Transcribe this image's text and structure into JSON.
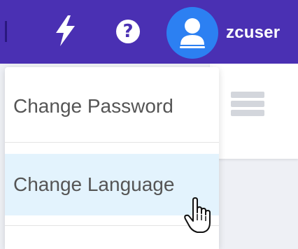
{
  "header": {
    "username": "zcuser",
    "icons": {
      "activity": "lightning-icon",
      "help": "help-icon",
      "user": "user-avatar-icon"
    },
    "colors": {
      "bar": "#4a30b3",
      "avatar": "#2c80f2"
    }
  },
  "user_menu": {
    "items": [
      {
        "label": "Change Password"
      },
      {
        "label": "Change Language"
      }
    ],
    "hovered_index": 1,
    "hover_color": "#e3f3fd"
  },
  "content": {
    "icon": "list-icon"
  }
}
